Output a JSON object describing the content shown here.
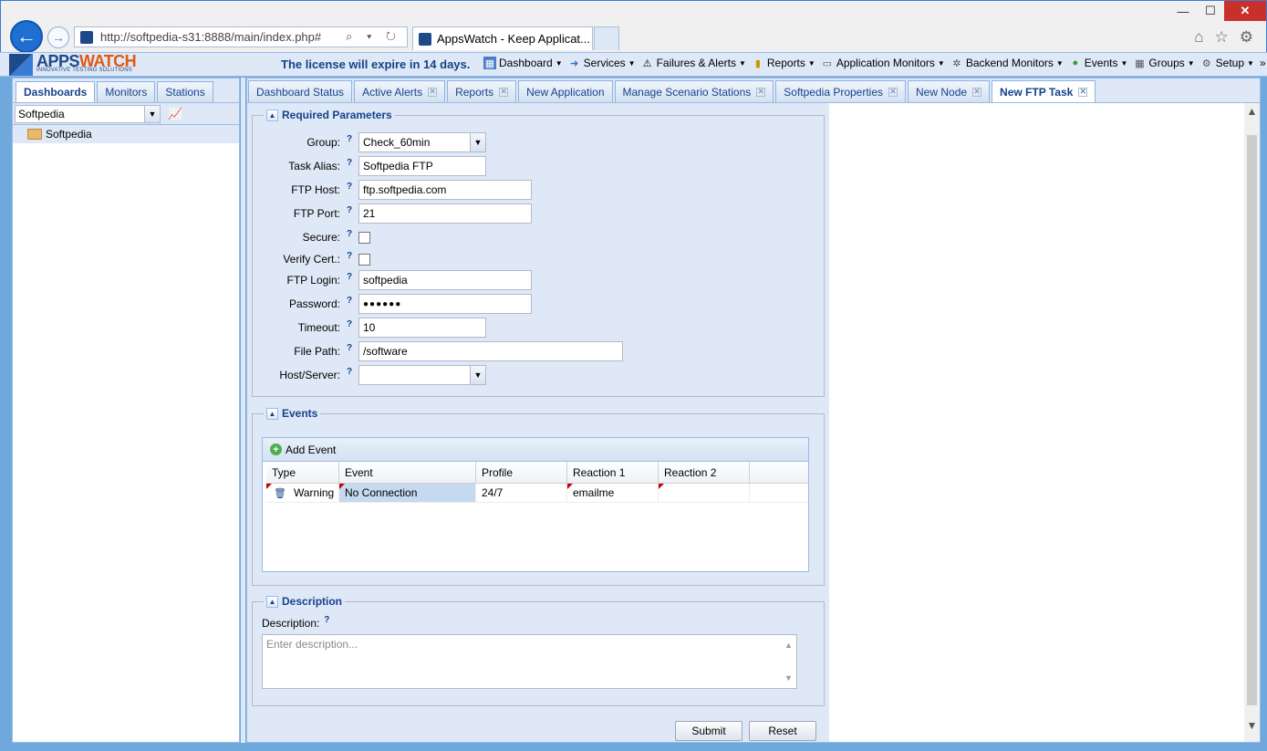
{
  "browser": {
    "url": "http://softpedia-s31:8888/main/index.php#",
    "tab_title": "AppsWatch - Keep Applicat...",
    "win_min": "—",
    "win_max": "☐",
    "win_close": "✕",
    "addr_tools": "⌕ ▾ ↻"
  },
  "app": {
    "logo_apps": "APPS",
    "logo_watch": "WATCH",
    "logo_tagline": "INNOVATIVE TESTING SOLUTIONS",
    "license_text": "The license will expire in 14 days.",
    "menu": [
      {
        "label": "Dashboard",
        "icon": "dashboard-icon"
      },
      {
        "label": "Services",
        "icon": "services-icon"
      },
      {
        "label": "Failures & Alerts",
        "icon": "warning-icon"
      },
      {
        "label": "Reports",
        "icon": "reports-icon"
      },
      {
        "label": "Application Monitors",
        "icon": "monitor-icon"
      },
      {
        "label": "Backend Monitors",
        "icon": "backend-icon"
      },
      {
        "label": "Events",
        "icon": "events-icon"
      },
      {
        "label": "Groups",
        "icon": "groups-icon"
      },
      {
        "label": "Setup",
        "icon": "gear-icon"
      }
    ],
    "menu_overflow": "»"
  },
  "left": {
    "tabs": [
      "Dashboards",
      "Monitors",
      "Stations"
    ],
    "active_tab": "Dashboards",
    "combo_value": "Softpedia",
    "tree_item": "Softpedia"
  },
  "main": {
    "tabs": [
      {
        "label": "Dashboard Status",
        "closable": false
      },
      {
        "label": "Active Alerts",
        "closable": true
      },
      {
        "label": "Reports",
        "closable": true
      },
      {
        "label": "New Application",
        "closable": false
      },
      {
        "label": "Manage Scenario Stations",
        "closable": true
      },
      {
        "label": "Softpedia Properties",
        "closable": true
      },
      {
        "label": "New Node",
        "closable": true
      },
      {
        "label": "New FTP Task",
        "closable": true
      }
    ],
    "active_tab": "New FTP Task"
  },
  "required": {
    "title": "Required Parameters",
    "help": "?",
    "fields": {
      "group": {
        "label": "Group:",
        "value": "Check_60min"
      },
      "alias": {
        "label": "Task Alias:",
        "value": "Softpedia FTP"
      },
      "host": {
        "label": "FTP Host:",
        "value": "ftp.softpedia.com"
      },
      "port": {
        "label": "FTP Port:",
        "value": "21"
      },
      "secure": {
        "label": "Secure:",
        "checked": false
      },
      "verify": {
        "label": "Verify Cert.:",
        "checked": false
      },
      "login": {
        "label": "FTP Login:",
        "value": "softpedia"
      },
      "password": {
        "label": "Password:",
        "value": "●●●●●●"
      },
      "timeout": {
        "label": "Timeout:",
        "value": "10"
      },
      "path": {
        "label": "File Path:",
        "value": "/software"
      },
      "hostserver": {
        "label": "Host/Server:",
        "value": ""
      }
    }
  },
  "events": {
    "title": "Events",
    "add_label": "Add Event",
    "columns": [
      "Type",
      "Event",
      "Profile",
      "Reaction 1",
      "Reaction 2"
    ],
    "rows": [
      {
        "type": "Warning",
        "event": "No Connection",
        "profile": "24/7",
        "reaction1": "emailme",
        "reaction2": ""
      }
    ]
  },
  "description": {
    "title": "Description",
    "label": "Description:",
    "placeholder": "Enter description..."
  },
  "buttons": {
    "submit": "Submit",
    "reset": "Reset"
  }
}
